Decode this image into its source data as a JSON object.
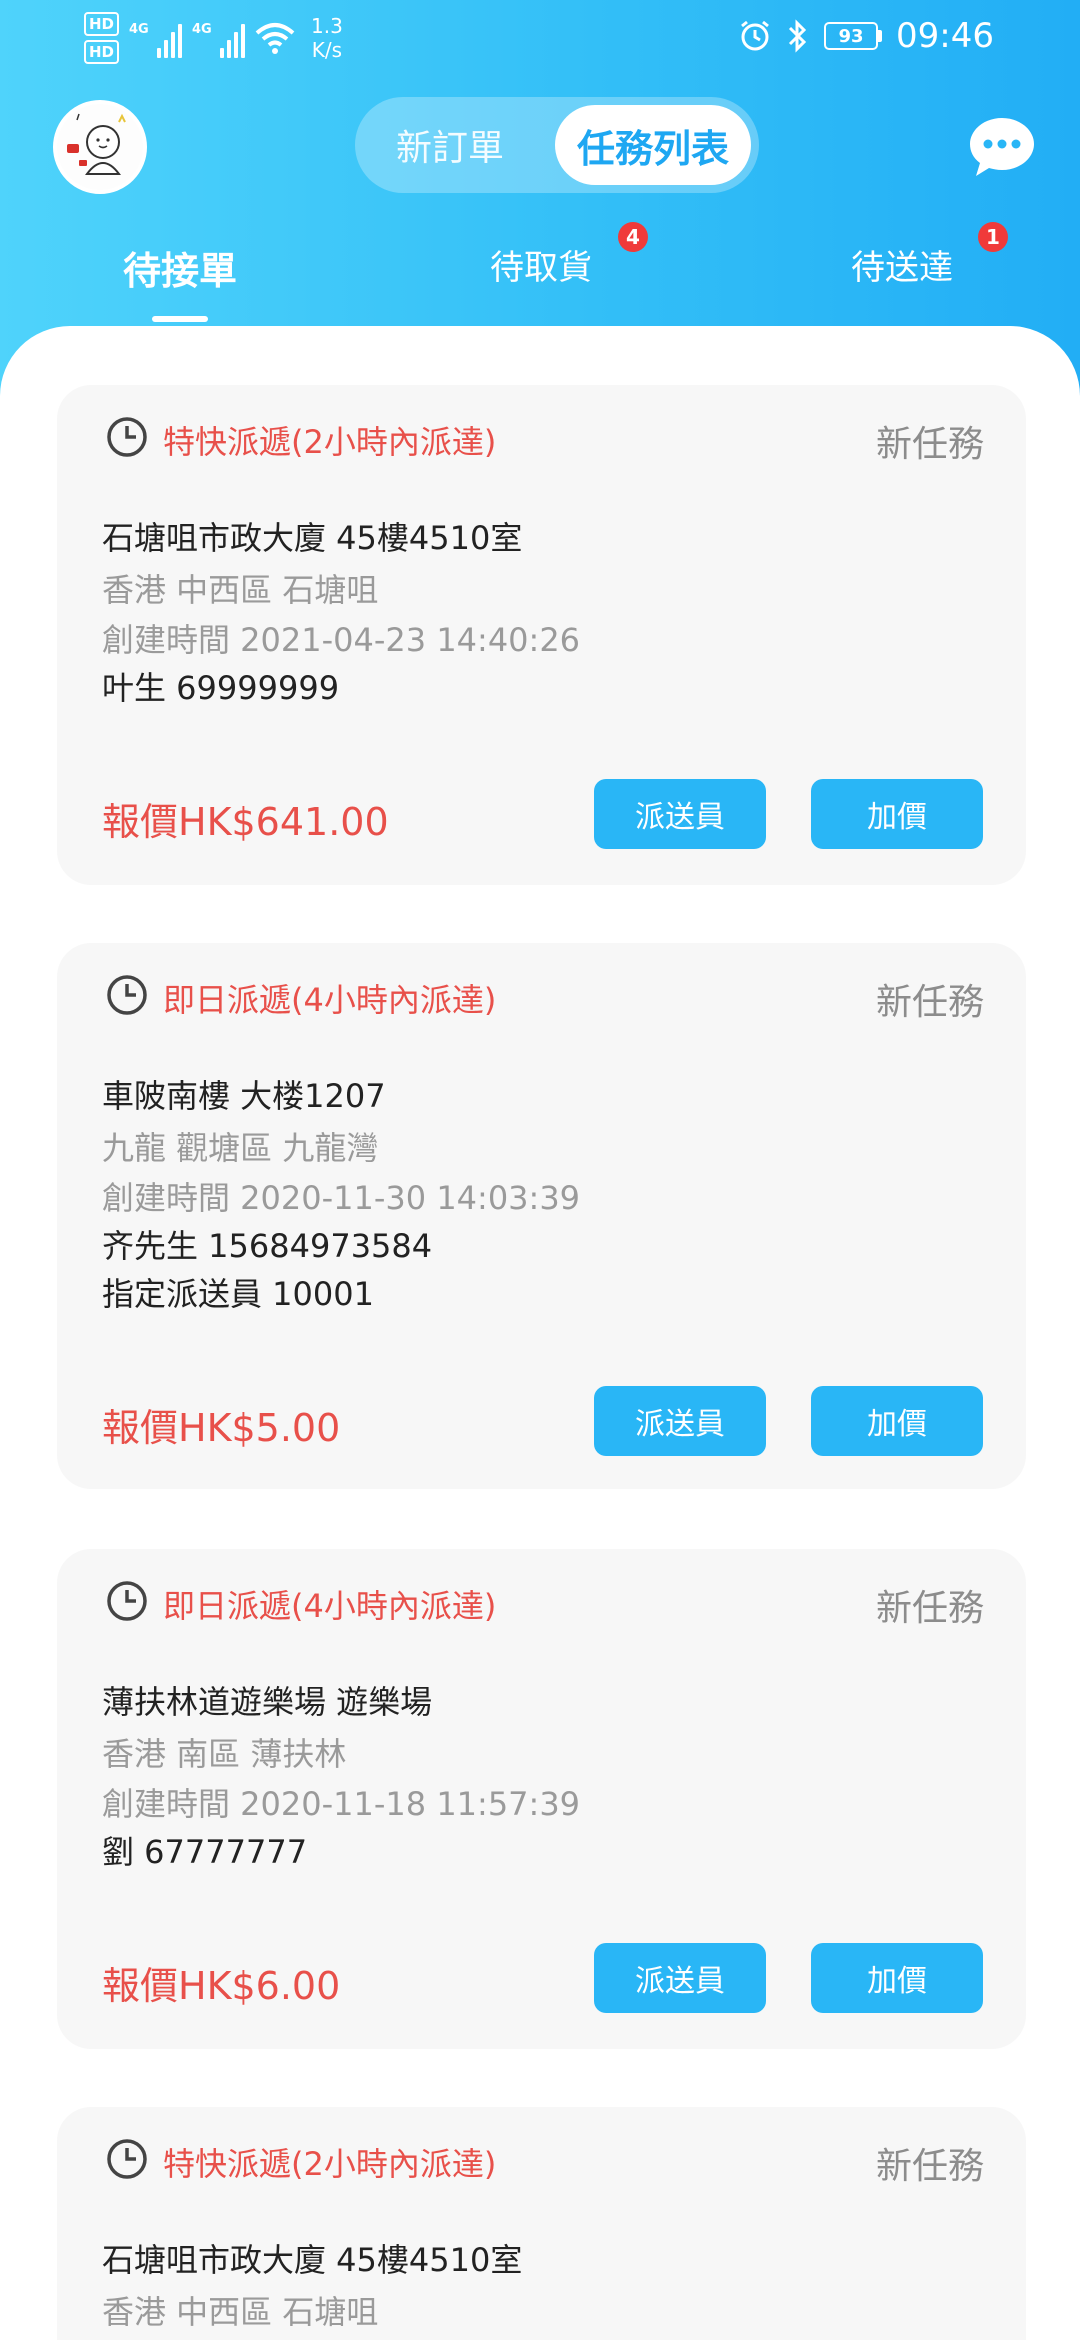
{
  "status_bar": {
    "hd1": "HD",
    "hd2": "HD",
    "net1": "4G",
    "net2": "4G",
    "speed_value": "1.3",
    "speed_unit": "K/s",
    "battery": "93",
    "time": "09:46"
  },
  "header": {
    "segment_new_order": "新訂單",
    "segment_task_list": "任務列表"
  },
  "tabs": [
    {
      "label": "待接單",
      "badge": ""
    },
    {
      "label": "待取貨",
      "badge": "4"
    },
    {
      "label": "待送達",
      "badge": "1"
    }
  ],
  "orders": [
    {
      "type": "特快派遞(2小時內派達)",
      "status": "新任務",
      "address": "石塘咀市政大廈 45樓4510室",
      "region": "香港 中西區 石塘咀",
      "created": "創建時間 2021-04-23 14:40:26",
      "contact": "叶生  69999999",
      "price": "報價HK$641.00",
      "btn_courier": "派送員",
      "btn_raise": "加價"
    },
    {
      "type": "即日派遞(4小時內派達)",
      "status": "新任務",
      "address": "車陂南樓 大楼1207",
      "region": "九龍 觀塘區 九龍灣",
      "created": "創建時間 2020-11-30 14:03:39",
      "contact": "齐先生  15684973584",
      "assigned": "指定派送員 10001",
      "price": "報價HK$5.00",
      "btn_courier": "派送員",
      "btn_raise": "加價"
    },
    {
      "type": "即日派遞(4小時內派達)",
      "status": "新任務",
      "address": "薄扶林道遊樂場 遊樂場",
      "region": "香港 南區 薄扶林",
      "created": "創建時間 2020-11-18 11:57:39",
      "contact": "劉  67777777",
      "price": "報價HK$6.00",
      "btn_courier": "派送員",
      "btn_raise": "加價"
    },
    {
      "type": "特快派遞(2小時內派達)",
      "status": "新任務",
      "address": "石塘咀市政大廈 45樓4510室",
      "region": "香港 中西區 石塘咀"
    }
  ],
  "colors": {
    "accent": "#29b6f6",
    "header_start": "#4fd3fb",
    "header_end": "#22aef5",
    "price_red": "#e8504a",
    "badge_red": "#f03a3a"
  },
  "icons": [
    "avatar-image",
    "alarm-icon",
    "bluetooth-icon",
    "wifi-icon",
    "chat-bubble-icon",
    "clock-icon"
  ]
}
